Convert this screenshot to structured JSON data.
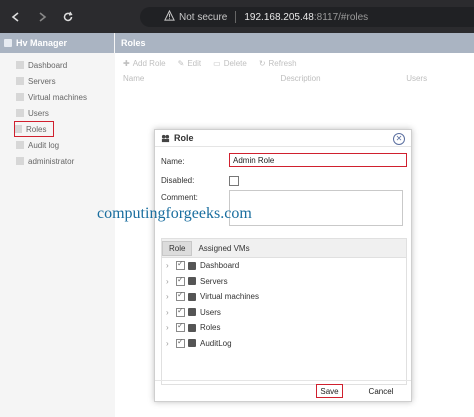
{
  "browser": {
    "security_label": "Not secure",
    "url_host": "192.168.205.48",
    "url_rest": ":8117/#roles"
  },
  "app": {
    "left_title": "Hv Manager",
    "nav": [
      "Dashboard",
      "Servers",
      "Virtual machines",
      "Users",
      "Roles",
      "Audit log",
      "administrator"
    ],
    "main_title": "Roles",
    "toolbar": {
      "add": "Add Role",
      "edit": "Edit",
      "delete": "Delete",
      "refresh": "Refresh"
    },
    "columns": {
      "name": "Name",
      "description": "Description",
      "users": "Users"
    }
  },
  "dialog": {
    "title": "Role",
    "name_label": "Name:",
    "name_value": "Admin Role",
    "disabled_label": "Disabled:",
    "comment_label": "Comment:",
    "tabs": [
      "Role",
      "Assigned VMs"
    ],
    "tree": [
      "Dashboard",
      "Servers",
      "Virtual machines",
      "Users",
      "Roles",
      "AuditLog"
    ],
    "save": "Save",
    "cancel": "Cancel"
  },
  "watermark": "computingforgeeks.com",
  "colors": {
    "highlight": "#d0202e",
    "header": "#aab4c2",
    "watermark": "#1a6e9f"
  }
}
